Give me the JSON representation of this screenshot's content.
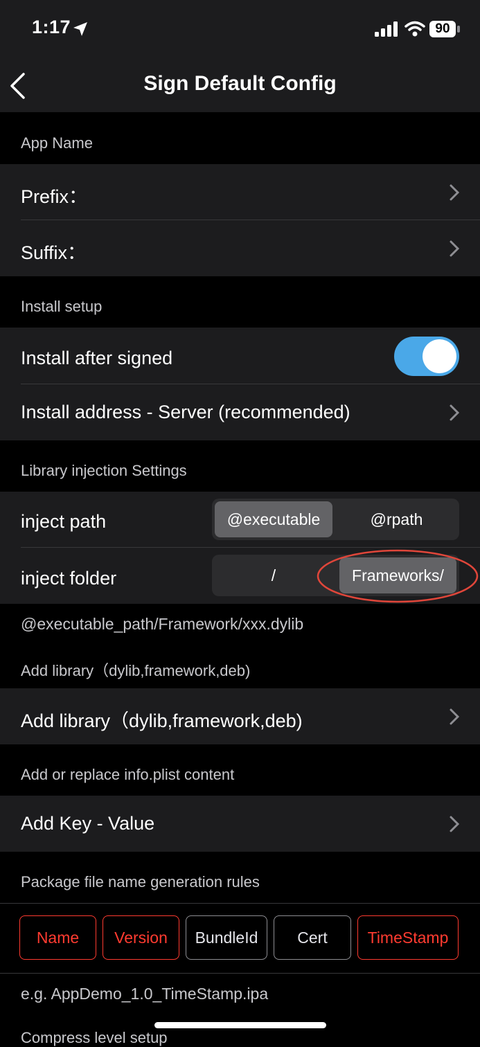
{
  "status_bar": {
    "time": "1:17",
    "battery": "90"
  },
  "nav": {
    "title": "Sign Default Config"
  },
  "sections": {
    "app_name": "App Name",
    "install_setup": "Install setup",
    "library_injection": "Library injection Settings",
    "add_library": "Add library（dylib,framework,deb)",
    "info_plist": "Add or replace info.plist content",
    "package_rules": "Package file name generation rules",
    "compress": "Compress level setup"
  },
  "rows": {
    "prefix": "Prefix：",
    "suffix": "Suffix：",
    "install_after_signed": "Install after signed",
    "install_after_signed_on": true,
    "install_address": "Install address - Server (recommended)",
    "inject_path": "inject path",
    "inject_folder": "inject folder",
    "add_library": "Add library（dylib,framework,deb)",
    "add_key_value": "Add Key - Value"
  },
  "inject_path_options": [
    "@executable",
    "@rpath"
  ],
  "inject_path_selected": "@executable",
  "inject_folder_options": [
    "/",
    "Frameworks/"
  ],
  "inject_folder_selected": "Frameworks/",
  "inject_path_preview": "@executable_path/Framework/xxx.dylib",
  "rule_buttons": [
    {
      "label": "Name",
      "active": true
    },
    {
      "label": "Version",
      "active": true
    },
    {
      "label": "BundleId",
      "active": false
    },
    {
      "label": "Cert",
      "active": false
    },
    {
      "label": "TimeStamp",
      "active": true
    }
  ],
  "example_filename": "e.g. AppDemo_1.0_TimeStamp.ipa",
  "colors": {
    "accent_toggle": "#4aa8e8",
    "active_rule": "#ff3b30",
    "annotation": "#e0463a"
  }
}
